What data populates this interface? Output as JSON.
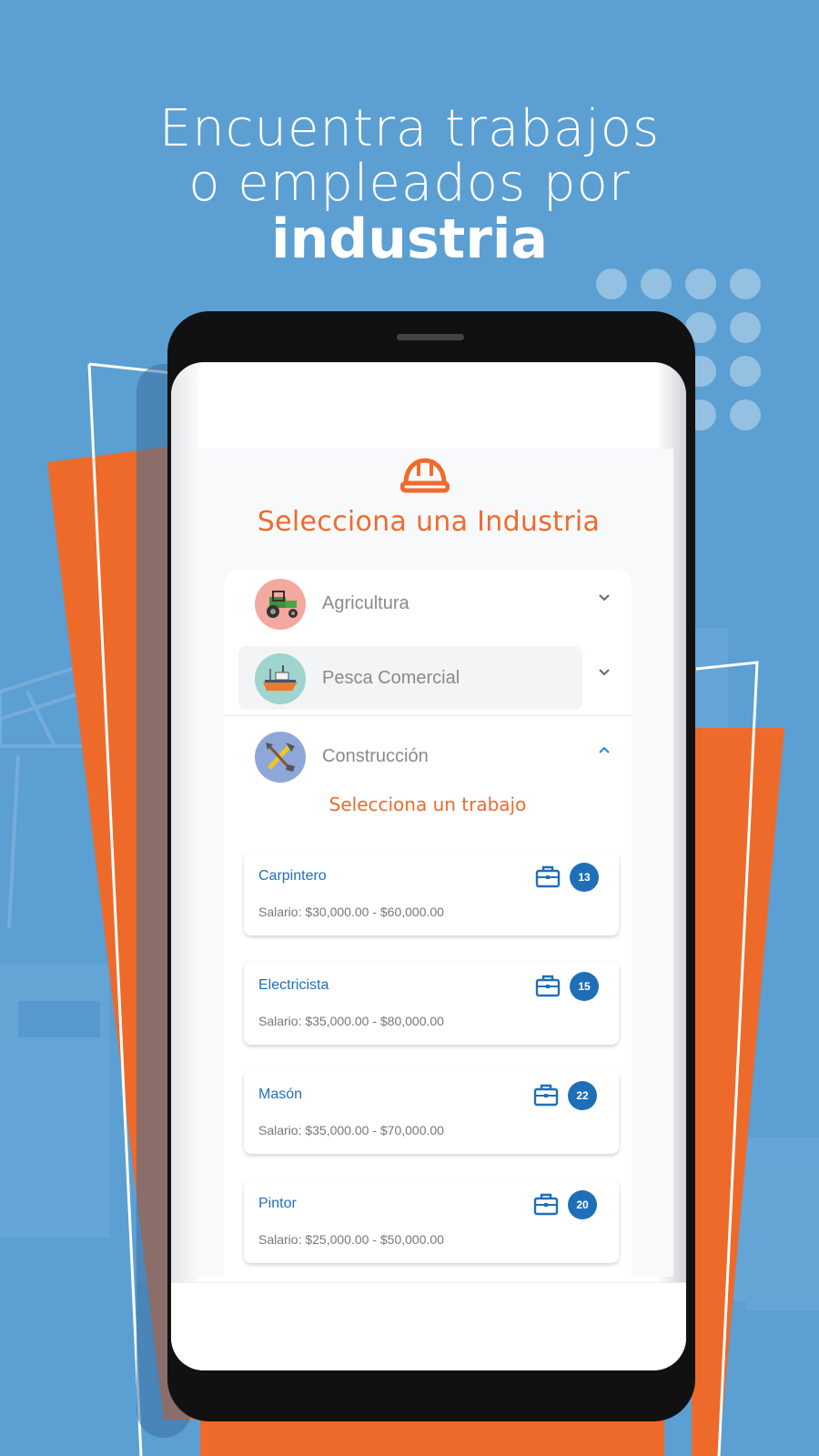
{
  "hero": {
    "line1": "Encuentra trabajos",
    "line2": "o empleados por",
    "line3": "industria"
  },
  "colors": {
    "background": "#5b9fd3",
    "accent": "#ef6b2c",
    "primary": "#1f6fb8"
  },
  "screen": {
    "header_icon": "hard-hat-icon",
    "title": "Selecciona una Industria",
    "industries": [
      {
        "label": "Agricultura",
        "icon": "tractor-icon",
        "expanded": false
      },
      {
        "label": "Pesca Comercial",
        "icon": "boat-icon",
        "expanded": false
      },
      {
        "label": "Construcción",
        "icon": "tools-icon",
        "expanded": true
      }
    ],
    "jobs_title": "Selecciona un trabajo",
    "jobs": [
      {
        "name": "Carpintero",
        "salary": "Salario: $30,000.00 - $60,000.00",
        "count": "13"
      },
      {
        "name": "Electricista",
        "salary": "Salario: $35,000.00 - $80,000.00",
        "count": "15"
      },
      {
        "name": "Masón",
        "salary": "Salario: $35,000.00 - $70,000.00",
        "count": "22"
      },
      {
        "name": "Pintor",
        "salary": "Salario: $25,000.00 - $50,000.00",
        "count": "20"
      }
    ]
  }
}
